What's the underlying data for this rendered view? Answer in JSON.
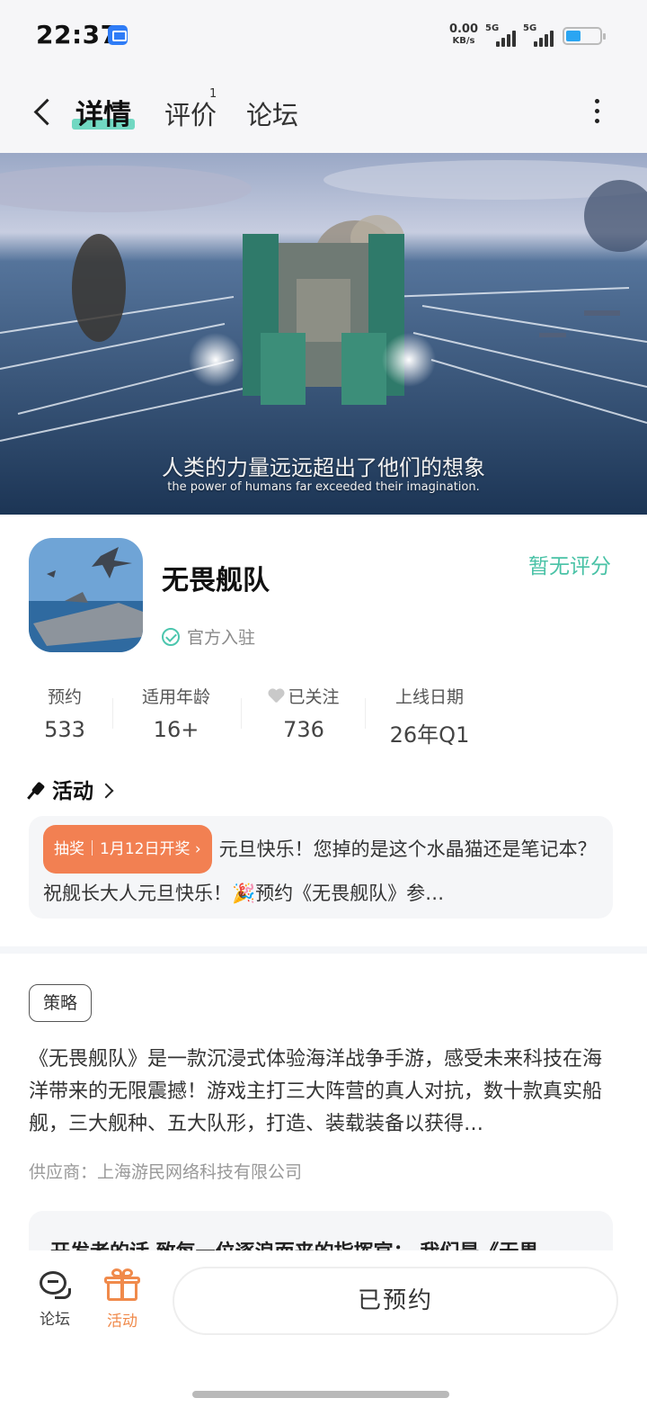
{
  "status_bar": {
    "time": "22:37",
    "net_speed_value": "0.00",
    "net_speed_unit": "KB/s",
    "signal1_label": "5G",
    "signal2_label": "5G",
    "battery_level": 0.45,
    "battery_color": "#2aa5f2"
  },
  "nav": {
    "tabs": [
      {
        "label": "详情",
        "active": true
      },
      {
        "label": "评价",
        "badge": "1"
      },
      {
        "label": "论坛"
      }
    ],
    "accent": "#59d2b9"
  },
  "banner": {
    "caption_cn": "人类的力量远远超出了他们的想象",
    "caption_en": "the power of humans far exceeded their imagination."
  },
  "game": {
    "name": "无畏舰队",
    "official_label": "官方入驻",
    "rating_text": "暂无评分",
    "stats": [
      {
        "label": "预约",
        "value": "533"
      },
      {
        "label": "适用年龄",
        "value": "16+"
      },
      {
        "label": "已关注",
        "value": "736"
      },
      {
        "label": "上线日期",
        "value": "26年Q1"
      }
    ]
  },
  "activity": {
    "header": "活动",
    "tag": "抽奖｜1月12日开奖",
    "text": "元旦快乐！您掉的是这个水晶猫还是笔记本？ 祝舰长大人元旦快乐！🎉预约《无畏舰队》参…"
  },
  "strategy_tag": "策略",
  "description": "《无畏舰队》是一款沉浸式体验海洋战争手游，感受未来科技在海洋带来的无限震撼！游戏主打三大阵营的真人对抗，数十款真实船舰，三大舰种、五大队形，打造、装载装备以获得…",
  "supplier": "供应商：上海游民网络科技有限公司",
  "developer_note": "开发者的话 致每一位逐浪而来的指挥官： 我们是《无畏",
  "bottom_bar": {
    "forum_label": "论坛",
    "activity_label": "活动",
    "reserved_label": "已预约",
    "activity_color": "#f08a4b"
  }
}
